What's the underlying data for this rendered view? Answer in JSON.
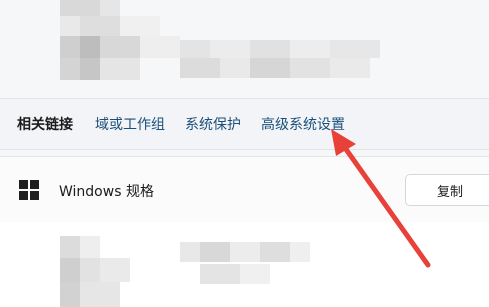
{
  "related": {
    "label": "相关链接",
    "links": [
      "域或工作组",
      "系统保护",
      "高级系统设置"
    ]
  },
  "spec": {
    "title": "Windows 规格",
    "copy_label": "复制",
    "icon": "windows-logo-icon"
  },
  "annotation": {
    "arrow_color": "#e8413a",
    "target": "高级系统设置"
  },
  "colors": {
    "link": "#1a4f7a",
    "bar_bg": "#f3f4f7",
    "card_bg": "#fbfbfc"
  }
}
